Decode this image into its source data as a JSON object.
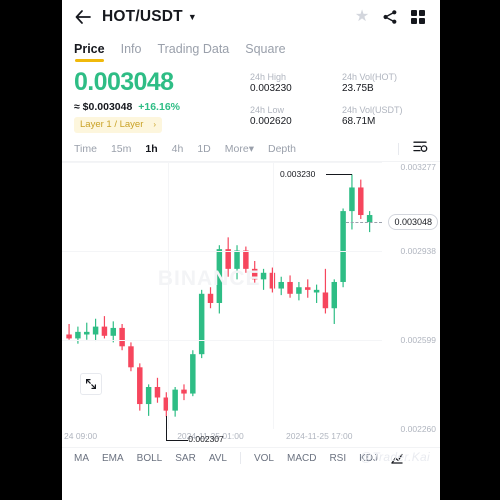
{
  "header": {
    "back_icon": "back-arrow-icon",
    "pair": "HOT/USDT",
    "caret": "▼",
    "star_icon": "star-icon",
    "share_icon": "share-icon",
    "grid_icon": "grid-menu-icon"
  },
  "tabs": [
    {
      "label": "Price",
      "active": true
    },
    {
      "label": "Info",
      "active": false
    },
    {
      "label": "Trading Data",
      "active": false
    },
    {
      "label": "Square",
      "active": false
    }
  ],
  "price": {
    "last": "0.003048",
    "approx_label": "≈ $0.003048",
    "change_pct": "+16.16%",
    "tag": "Layer 1 / Layer",
    "tag_chevron": "›",
    "color_up": "#2EBD85",
    "color_down": "#F6465D"
  },
  "stats": [
    {
      "label": "24h High",
      "value": "0.003230"
    },
    {
      "label": "24h Vol(HOT)",
      "value": "23.75B"
    },
    {
      "label": "24h Low",
      "value": "0.002620"
    },
    {
      "label": "24h Vol(USDT)",
      "value": "68.71M"
    }
  ],
  "chart_toolbar": {
    "items": [
      {
        "label": "Time",
        "active": false
      },
      {
        "label": "15m",
        "active": false
      },
      {
        "label": "1h",
        "active": true
      },
      {
        "label": "4h",
        "active": false
      },
      {
        "label": "1D",
        "active": false
      },
      {
        "label": "More",
        "active": false,
        "caret": "▾"
      },
      {
        "label": "Depth",
        "active": false
      }
    ],
    "settings_icon": "chart-settings-icon"
  },
  "chart_data": {
    "type": "candlestick",
    "title": "HOT/USDT 1h",
    "watermark": "BINANCE",
    "ylim": [
      0.00226,
      0.003277
    ],
    "y_ticks": [
      "0.003277",
      "0.002938",
      "0.002599",
      "0.002260"
    ],
    "y_tick_values": [
      0.003277,
      0.002938,
      0.002599,
      0.00226
    ],
    "extra_y_label": "0.003048",
    "x_ticks": [
      "24 09:00",
      "2024-11-25 01:00",
      "2024-11-25 17:00"
    ],
    "current_price": "0.003048",
    "high_annotation": "0.003230",
    "low_annotation": "0.002307",
    "grid": true,
    "fullscreen_icon": "fullscreen-icon",
    "candles": [
      {
        "o": 0.00262,
        "h": 0.00266,
        "l": 0.0026,
        "c": 0.002605,
        "dir": "down"
      },
      {
        "o": 0.002605,
        "h": 0.00265,
        "l": 0.002585,
        "c": 0.00263,
        "dir": "up"
      },
      {
        "o": 0.00263,
        "h": 0.002665,
        "l": 0.0026,
        "c": 0.00262,
        "dir": "up"
      },
      {
        "o": 0.00262,
        "h": 0.00268,
        "l": 0.002595,
        "c": 0.00265,
        "dir": "up"
      },
      {
        "o": 0.00265,
        "h": 0.00269,
        "l": 0.002605,
        "c": 0.002615,
        "dir": "down"
      },
      {
        "o": 0.002615,
        "h": 0.00267,
        "l": 0.00259,
        "c": 0.002645,
        "dir": "up"
      },
      {
        "o": 0.002645,
        "h": 0.00266,
        "l": 0.00256,
        "c": 0.002575,
        "dir": "down"
      },
      {
        "o": 0.002575,
        "h": 0.00259,
        "l": 0.00248,
        "c": 0.002495,
        "dir": "down"
      },
      {
        "o": 0.002495,
        "h": 0.00251,
        "l": 0.00233,
        "c": 0.002355,
        "dir": "down"
      },
      {
        "o": 0.002355,
        "h": 0.00243,
        "l": 0.00231,
        "c": 0.00242,
        "dir": "up"
      },
      {
        "o": 0.00242,
        "h": 0.002455,
        "l": 0.00236,
        "c": 0.00238,
        "dir": "down"
      },
      {
        "o": 0.00238,
        "h": 0.0024,
        "l": 0.002307,
        "c": 0.00233,
        "dir": "down"
      },
      {
        "o": 0.00233,
        "h": 0.00242,
        "l": 0.002307,
        "c": 0.00241,
        "dir": "up"
      },
      {
        "o": 0.00241,
        "h": 0.00243,
        "l": 0.00237,
        "c": 0.002395,
        "dir": "down"
      },
      {
        "o": 0.002395,
        "h": 0.00256,
        "l": 0.002385,
        "c": 0.002545,
        "dir": "up"
      },
      {
        "o": 0.002545,
        "h": 0.00279,
        "l": 0.00253,
        "c": 0.002775,
        "dir": "up"
      },
      {
        "o": 0.002775,
        "h": 0.0028,
        "l": 0.00272,
        "c": 0.00274,
        "dir": "down"
      },
      {
        "o": 0.00274,
        "h": 0.00296,
        "l": 0.0027,
        "c": 0.002945,
        "dir": "up"
      },
      {
        "o": 0.002945,
        "h": 0.00299,
        "l": 0.00284,
        "c": 0.00287,
        "dir": "down"
      },
      {
        "o": 0.00287,
        "h": 0.00296,
        "l": 0.00283,
        "c": 0.00294,
        "dir": "up"
      },
      {
        "o": 0.00294,
        "h": 0.002955,
        "l": 0.002855,
        "c": 0.00287,
        "dir": "down"
      },
      {
        "o": 0.00287,
        "h": 0.0029,
        "l": 0.00281,
        "c": 0.00283,
        "dir": "down"
      },
      {
        "o": 0.00283,
        "h": 0.00287,
        "l": 0.00279,
        "c": 0.002855,
        "dir": "up"
      },
      {
        "o": 0.002855,
        "h": 0.002875,
        "l": 0.00278,
        "c": 0.002795,
        "dir": "down"
      },
      {
        "o": 0.002795,
        "h": 0.00284,
        "l": 0.00277,
        "c": 0.00282,
        "dir": "up"
      },
      {
        "o": 0.00282,
        "h": 0.002845,
        "l": 0.00276,
        "c": 0.002775,
        "dir": "down"
      },
      {
        "o": 0.002775,
        "h": 0.00282,
        "l": 0.00275,
        "c": 0.0028,
        "dir": "up"
      },
      {
        "o": 0.0028,
        "h": 0.00283,
        "l": 0.00276,
        "c": 0.00279,
        "dir": "down"
      },
      {
        "o": 0.00279,
        "h": 0.00281,
        "l": 0.00274,
        "c": 0.00278,
        "dir": "up"
      },
      {
        "o": 0.00278,
        "h": 0.00287,
        "l": 0.0027,
        "c": 0.00272,
        "dir": "down"
      },
      {
        "o": 0.00272,
        "h": 0.00283,
        "l": 0.00266,
        "c": 0.00282,
        "dir": "up"
      },
      {
        "o": 0.00282,
        "h": 0.0031,
        "l": 0.0028,
        "c": 0.00309,
        "dir": "up"
      },
      {
        "o": 0.00309,
        "h": 0.00323,
        "l": 0.00302,
        "c": 0.00318,
        "dir": "up"
      },
      {
        "o": 0.00318,
        "h": 0.00321,
        "l": 0.00306,
        "c": 0.003075,
        "dir": "down"
      },
      {
        "o": 0.003075,
        "h": 0.00309,
        "l": 0.00301,
        "c": 0.003048,
        "dir": "up"
      }
    ]
  },
  "indicators": {
    "items": [
      "MA",
      "EMA",
      "BOLL",
      "SAR",
      "AVL",
      "VOL",
      "MACD",
      "RSI",
      "KDJ"
    ],
    "chart_type_icon": "chart-type-icon",
    "watermark": "@Trader.Kai"
  }
}
